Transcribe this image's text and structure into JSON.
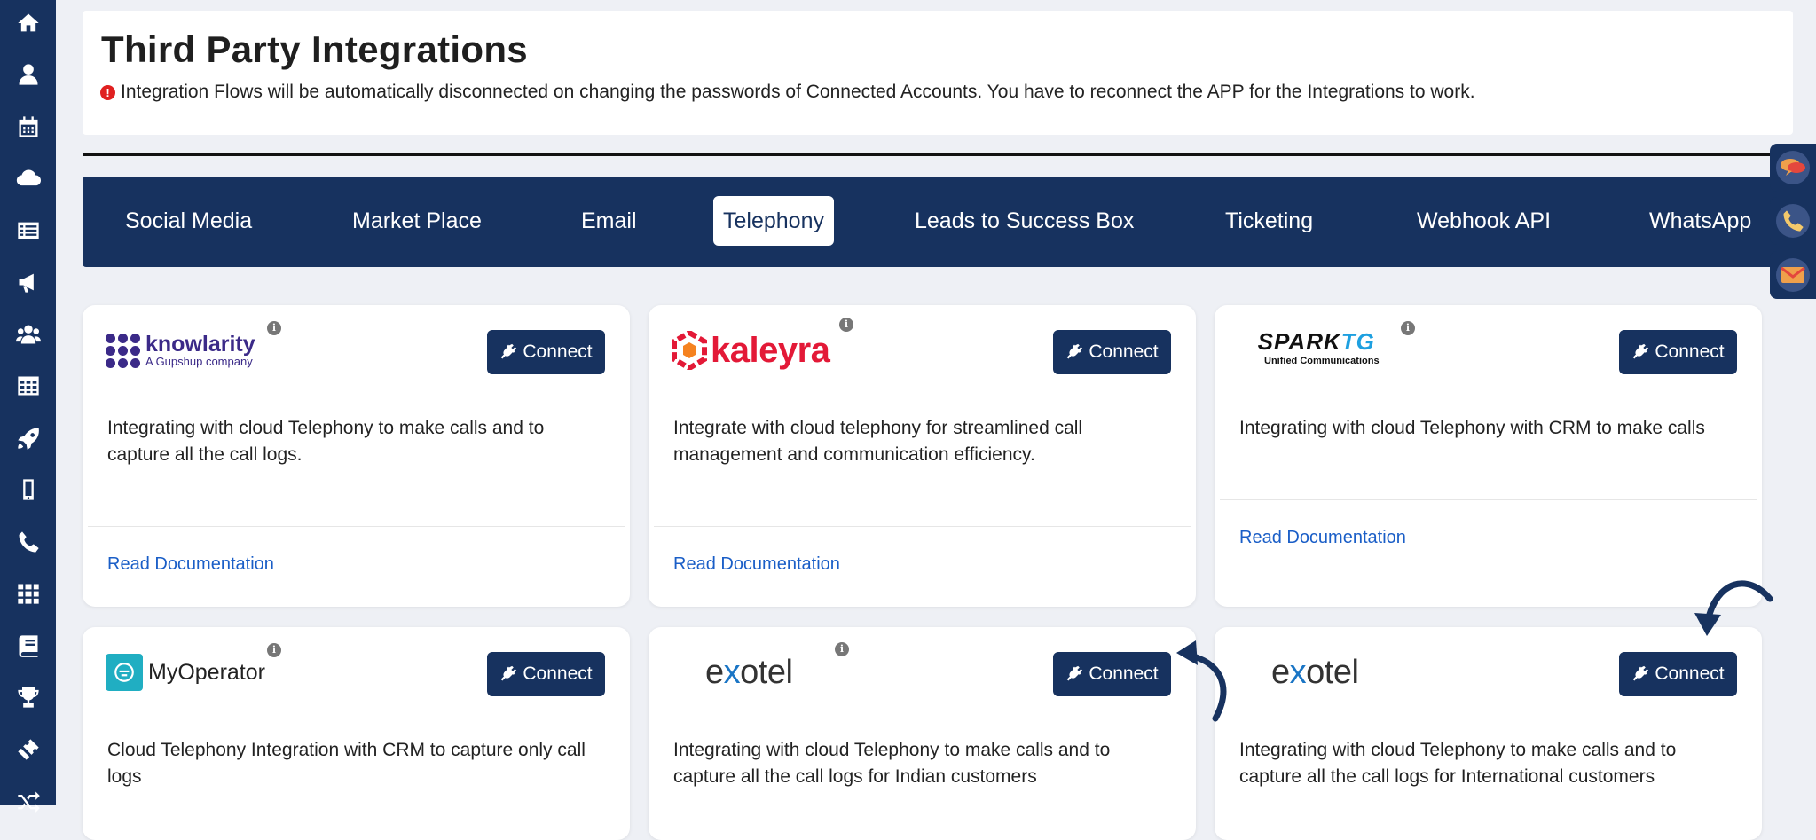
{
  "header": {
    "title": "Third Party Integrations",
    "notice": "Integration Flows will be automatically disconnected on changing the passwords of Connected Accounts. You have to reconnect the APP for the Integrations to work."
  },
  "sidebar": {
    "items": [
      {
        "icon": "home-icon"
      },
      {
        "icon": "user-icon"
      },
      {
        "icon": "calendar-icon"
      },
      {
        "icon": "cloud-icon"
      },
      {
        "icon": "list-icon"
      },
      {
        "icon": "megaphone-icon"
      },
      {
        "icon": "users-icon"
      },
      {
        "icon": "table-icon"
      },
      {
        "icon": "rocket-icon"
      },
      {
        "icon": "mobile-icon"
      },
      {
        "icon": "phone-icon"
      },
      {
        "icon": "apps-grid-icon"
      },
      {
        "icon": "book-icon"
      },
      {
        "icon": "trophy-icon"
      },
      {
        "icon": "ticket-icon"
      },
      {
        "icon": "shuffle-icon"
      }
    ]
  },
  "tabs": [
    {
      "label": "Social Media"
    },
    {
      "label": "Market Place"
    },
    {
      "label": "Email"
    },
    {
      "label": "Telephony",
      "active": true
    },
    {
      "label": "Leads to Success Box"
    },
    {
      "label": "Ticketing"
    },
    {
      "label": "Webhook API"
    },
    {
      "label": "WhatsApp"
    }
  ],
  "right_widgets": [
    {
      "icon": "chat-bubbles-icon"
    },
    {
      "icon": "phone-call-icon"
    },
    {
      "icon": "mail-icon"
    }
  ],
  "cards": [
    {
      "logo": "knowlarity-logo",
      "logo_name": "knowlarity",
      "logo_sub": "A Gupshup company",
      "button": "Connect",
      "description": "Integrating with cloud Telephony to make calls and to capture all the call logs.",
      "link": "Read Documentation"
    },
    {
      "logo": "kaleyra-logo",
      "logo_name": "kaleyra",
      "button": "Connect",
      "description": "Integrate with cloud telephony for streamlined call management and communication efficiency.",
      "link": "Read Documentation"
    },
    {
      "logo": "sparktg-logo",
      "logo_name_a": "SPARK",
      "logo_name_b": "TG",
      "logo_sub": "Unified Communications",
      "button": "Connect",
      "description": "Integrating with cloud Telephony with CRM to make calls",
      "link": "Read Documentation"
    },
    {
      "logo": "myoperator-logo",
      "logo_name": "MyOperator",
      "button": "Connect",
      "description": "Cloud Telephony Integration with CRM to capture only call logs"
    },
    {
      "logo": "exotel-logo",
      "logo_name_a": "e",
      "logo_name_x": "x",
      "logo_name_b": "otel",
      "button": "Connect",
      "description": "Integrating with cloud Telephony to make calls and to capture all the call logs for Indian customers"
    },
    {
      "logo": "exotel-logo",
      "logo_name_a": "e",
      "logo_name_x": "x",
      "logo_name_b": "otel",
      "button": "Connect",
      "description": "Integrating with cloud Telephony to make calls and to capture all the call logs for International customers"
    }
  ],
  "colors": {
    "navy": "#17325f",
    "link": "#1a5ec7",
    "alert": "#e02020",
    "background": "#eef0f5"
  }
}
